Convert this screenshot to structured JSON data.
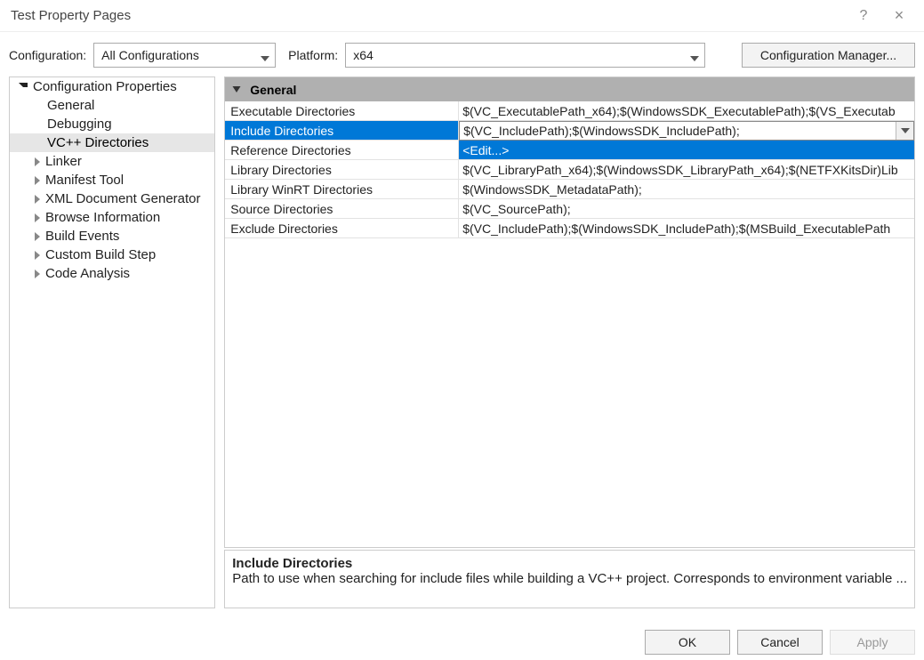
{
  "window": {
    "title": "Test Property Pages",
    "help": "?",
    "close": "×"
  },
  "toolbar": {
    "config_label": "Configuration:",
    "config_value": "All Configurations",
    "platform_label": "Platform:",
    "platform_value": "x64",
    "cfgmgr": "Configuration Manager..."
  },
  "tree": {
    "root": "Configuration Properties",
    "items": [
      {
        "label": "General",
        "expandable": false
      },
      {
        "label": "Debugging",
        "expandable": false
      },
      {
        "label": "VC++ Directories",
        "expandable": false,
        "selected": true
      },
      {
        "label": "Linker",
        "expandable": true
      },
      {
        "label": "Manifest Tool",
        "expandable": true
      },
      {
        "label": "XML Document Generator",
        "expandable": true
      },
      {
        "label": "Browse Information",
        "expandable": true
      },
      {
        "label": "Build Events",
        "expandable": true
      },
      {
        "label": "Custom Build Step",
        "expandable": true
      },
      {
        "label": "Code Analysis",
        "expandable": true
      }
    ]
  },
  "grid": {
    "group": "General",
    "rows": [
      {
        "name": "Executable Directories",
        "value": "$(VC_ExecutablePath_x64);$(WindowsSDK_ExecutablePath);$(VS_Executab"
      },
      {
        "name": "Include Directories",
        "value": "$(VC_IncludePath);$(WindowsSDK_IncludePath);",
        "selected": true
      },
      {
        "name": "Reference Directories",
        "value": "<Edit...>",
        "edit": true
      },
      {
        "name": "Library Directories",
        "value": "$(VC_LibraryPath_x64);$(WindowsSDK_LibraryPath_x64);$(NETFXKitsDir)Lib"
      },
      {
        "name": "Library WinRT Directories",
        "value": "$(WindowsSDK_MetadataPath);"
      },
      {
        "name": "Source Directories",
        "value": "$(VC_SourcePath);"
      },
      {
        "name": "Exclude Directories",
        "value": "$(VC_IncludePath);$(WindowsSDK_IncludePath);$(MSBuild_ExecutablePath"
      }
    ]
  },
  "description": {
    "name": "Include Directories",
    "text": "Path to use when searching for include files while building a VC++ project.  Corresponds to environment variable ..."
  },
  "footer": {
    "ok": "OK",
    "cancel": "Cancel",
    "apply": "Apply"
  }
}
